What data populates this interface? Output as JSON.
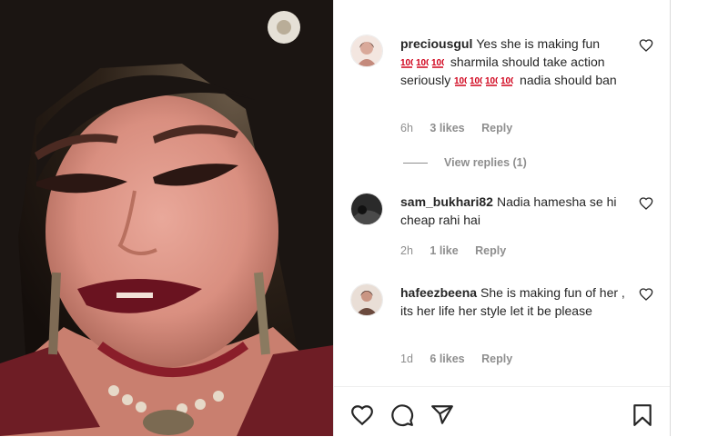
{
  "comments": [
    {
      "username": "preciousgul",
      "text_parts": [
        "Yes she is making fun",
        "sharmila should take action seriously",
        "nadia should ban"
      ],
      "time": "6h",
      "likes": "3 likes",
      "reply": "Reply",
      "view_replies": "View replies (1)"
    },
    {
      "username": "sam_bukhari82",
      "text": "Nadia hamesha se hi cheap rahi hai",
      "time": "2h",
      "likes": "1 like",
      "reply": "Reply"
    },
    {
      "username": "hafeezbeena",
      "text": "She is making fun of her , its her life her style let it be please",
      "time": "1d",
      "likes": "6 likes",
      "reply": "Reply"
    }
  ],
  "icons": {
    "like": "heart-icon",
    "comment": "comment-icon",
    "share": "share-icon",
    "save": "bookmark-icon",
    "emoji": "hundred-points-emoji"
  },
  "colors": {
    "text": "#262626",
    "meta": "#8e8e8e",
    "emoji": "#d0021b"
  }
}
